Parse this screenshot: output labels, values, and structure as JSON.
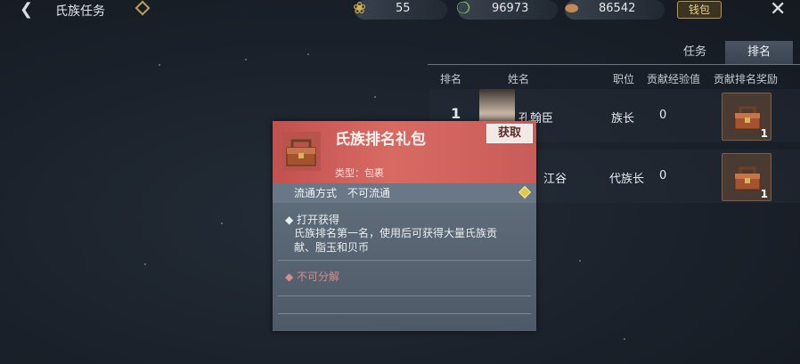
{
  "header": {
    "title": "氏族任务"
  },
  "resources": [
    {
      "icon": "feather-icon",
      "value": "55"
    },
    {
      "icon": "jade-coin-icon",
      "value": "96973"
    },
    {
      "icon": "shell-coin-icon",
      "value": "86542"
    }
  ],
  "wallet_label": "钱包",
  "tabs": [
    {
      "label": "任务",
      "active": false
    },
    {
      "label": "排名",
      "active": true
    }
  ],
  "table": {
    "headers": [
      "排名",
      "姓名",
      "职位",
      "贡献经验值",
      "贡献排名奖励"
    ],
    "rows": [
      {
        "rank": "1",
        "name": "孔翰臣",
        "position": "族长",
        "contribution": "0",
        "reward_count": "1"
      },
      {
        "rank": "",
        "name": "江谷",
        "position": "代族长",
        "contribution": "0",
        "reward_count": "1"
      }
    ]
  },
  "popup": {
    "item_name": "氏族排名礼包",
    "get_label": "获取",
    "item_type": "类型：包裹",
    "circulation": "流通方式　不可流通",
    "open_title": "打开获得",
    "open_desc": "氏族排名第一名，使用后可获得大量氏族贡献、脂玉和贝币",
    "no_decompose": "不可分解"
  },
  "colors": {
    "popup_header": "#d86a64",
    "accent_gold": "#e3c64b",
    "no_decompose_text": "#d88c8c"
  }
}
